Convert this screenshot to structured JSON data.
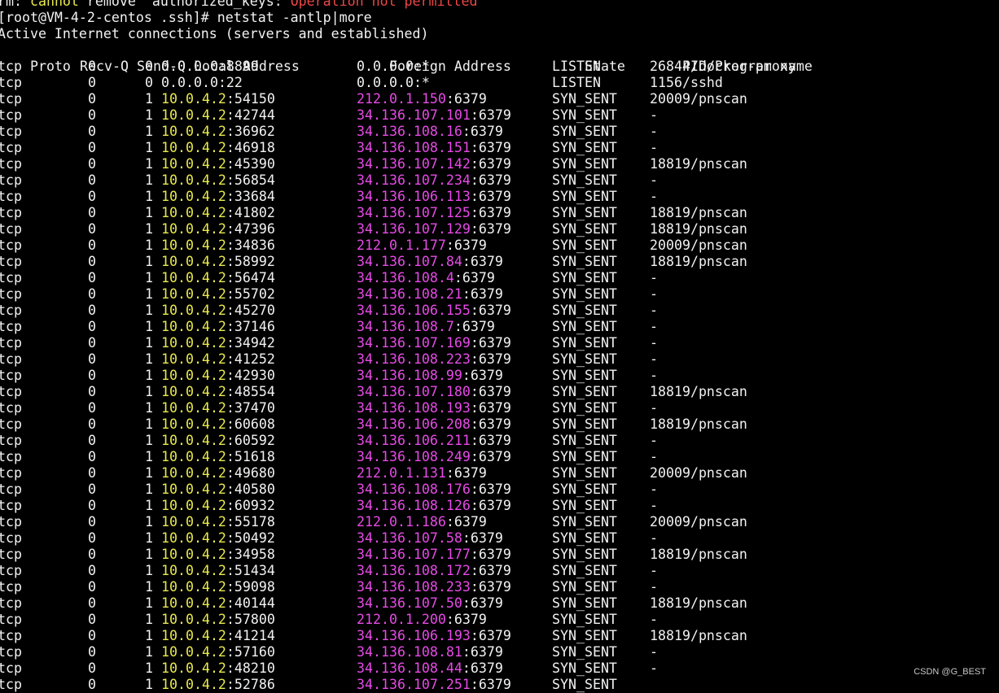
{
  "colors": {
    "background": "#000000",
    "text": "#f2f2f2",
    "local_ip": "#e9e94e",
    "foreign_ip": "#e84ae8",
    "error": "#f04646"
  },
  "terminal": {
    "rm_line": {
      "prefix": "rm: ",
      "cannot": "cannot",
      "remove": " remove  ",
      "file": "authorized_keys",
      "sep": ": ",
      "error": "Operation not permitted"
    },
    "prompt": "[root@VM-4-2-centos .ssh]# netstat -antlp|more",
    "banner": "Active Internet connections (servers and established)",
    "headers": {
      "proto": "Proto",
      "recvq": "Recv-Q",
      "sendq": "Send-Q",
      "local": "Local Address",
      "foreign": "Foreign Address",
      "state": "State",
      "prog": "PID/Program name"
    },
    "rows": [
      {
        "proto": "tcp",
        "recvq": "0",
        "sendq": "0",
        "local_ip": "0.0.0.0",
        "local_port": ":8899",
        "foreign_ip": "0.0.0.0",
        "foreign_port": ":*",
        "state": "LISTEN",
        "prog": "26844/docker-proxy",
        "colored": false
      },
      {
        "proto": "tcp",
        "recvq": "0",
        "sendq": "0",
        "local_ip": "0.0.0.0",
        "local_port": ":22",
        "foreign_ip": "0.0.0.0",
        "foreign_port": ":*",
        "state": "LISTEN",
        "prog": "1156/sshd",
        "colored": false
      },
      {
        "proto": "tcp",
        "recvq": "0",
        "sendq": "1",
        "local_ip": "10.0.4.2",
        "local_port": ":54150",
        "foreign_ip": "212.0.1.150",
        "foreign_port": ":6379",
        "state": "SYN_SENT",
        "prog": "20009/pnscan",
        "colored": true
      },
      {
        "proto": "tcp",
        "recvq": "0",
        "sendq": "1",
        "local_ip": "10.0.4.2",
        "local_port": ":42744",
        "foreign_ip": "34.136.107.101",
        "foreign_port": ":6379",
        "state": "SYN_SENT",
        "prog": "-",
        "colored": true
      },
      {
        "proto": "tcp",
        "recvq": "0",
        "sendq": "1",
        "local_ip": "10.0.4.2",
        "local_port": ":36962",
        "foreign_ip": "34.136.108.16",
        "foreign_port": ":6379",
        "state": "SYN_SENT",
        "prog": "-",
        "colored": true
      },
      {
        "proto": "tcp",
        "recvq": "0",
        "sendq": "1",
        "local_ip": "10.0.4.2",
        "local_port": ":46918",
        "foreign_ip": "34.136.108.151",
        "foreign_port": ":6379",
        "state": "SYN_SENT",
        "prog": "-",
        "colored": true
      },
      {
        "proto": "tcp",
        "recvq": "0",
        "sendq": "1",
        "local_ip": "10.0.4.2",
        "local_port": ":45390",
        "foreign_ip": "34.136.107.142",
        "foreign_port": ":6379",
        "state": "SYN_SENT",
        "prog": "18819/pnscan",
        "colored": true
      },
      {
        "proto": "tcp",
        "recvq": "0",
        "sendq": "1",
        "local_ip": "10.0.4.2",
        "local_port": ":56854",
        "foreign_ip": "34.136.107.234",
        "foreign_port": ":6379",
        "state": "SYN_SENT",
        "prog": "-",
        "colored": true
      },
      {
        "proto": "tcp",
        "recvq": "0",
        "sendq": "1",
        "local_ip": "10.0.4.2",
        "local_port": ":33684",
        "foreign_ip": "34.136.106.113",
        "foreign_port": ":6379",
        "state": "SYN_SENT",
        "prog": "-",
        "colored": true
      },
      {
        "proto": "tcp",
        "recvq": "0",
        "sendq": "1",
        "local_ip": "10.0.4.2",
        "local_port": ":41802",
        "foreign_ip": "34.136.107.125",
        "foreign_port": ":6379",
        "state": "SYN_SENT",
        "prog": "18819/pnscan",
        "colored": true
      },
      {
        "proto": "tcp",
        "recvq": "0",
        "sendq": "1",
        "local_ip": "10.0.4.2",
        "local_port": ":47396",
        "foreign_ip": "34.136.107.129",
        "foreign_port": ":6379",
        "state": "SYN_SENT",
        "prog": "18819/pnscan",
        "colored": true
      },
      {
        "proto": "tcp",
        "recvq": "0",
        "sendq": "1",
        "local_ip": "10.0.4.2",
        "local_port": ":34836",
        "foreign_ip": "212.0.1.177",
        "foreign_port": ":6379",
        "state": "SYN_SENT",
        "prog": "20009/pnscan",
        "colored": true
      },
      {
        "proto": "tcp",
        "recvq": "0",
        "sendq": "1",
        "local_ip": "10.0.4.2",
        "local_port": ":58992",
        "foreign_ip": "34.136.107.84",
        "foreign_port": ":6379",
        "state": "SYN_SENT",
        "prog": "18819/pnscan",
        "colored": true
      },
      {
        "proto": "tcp",
        "recvq": "0",
        "sendq": "1",
        "local_ip": "10.0.4.2",
        "local_port": ":56474",
        "foreign_ip": "34.136.108.4",
        "foreign_port": ":6379",
        "state": "SYN_SENT",
        "prog": "-",
        "colored": true
      },
      {
        "proto": "tcp",
        "recvq": "0",
        "sendq": "1",
        "local_ip": "10.0.4.2",
        "local_port": ":55702",
        "foreign_ip": "34.136.108.21",
        "foreign_port": ":6379",
        "state": "SYN_SENT",
        "prog": "-",
        "colored": true
      },
      {
        "proto": "tcp",
        "recvq": "0",
        "sendq": "1",
        "local_ip": "10.0.4.2",
        "local_port": ":45270",
        "foreign_ip": "34.136.106.155",
        "foreign_port": ":6379",
        "state": "SYN_SENT",
        "prog": "-",
        "colored": true
      },
      {
        "proto": "tcp",
        "recvq": "0",
        "sendq": "1",
        "local_ip": "10.0.4.2",
        "local_port": ":37146",
        "foreign_ip": "34.136.108.7",
        "foreign_port": ":6379",
        "state": "SYN_SENT",
        "prog": "-",
        "colored": true
      },
      {
        "proto": "tcp",
        "recvq": "0",
        "sendq": "1",
        "local_ip": "10.0.4.2",
        "local_port": ":34942",
        "foreign_ip": "34.136.107.169",
        "foreign_port": ":6379",
        "state": "SYN_SENT",
        "prog": "-",
        "colored": true
      },
      {
        "proto": "tcp",
        "recvq": "0",
        "sendq": "1",
        "local_ip": "10.0.4.2",
        "local_port": ":41252",
        "foreign_ip": "34.136.108.223",
        "foreign_port": ":6379",
        "state": "SYN_SENT",
        "prog": "-",
        "colored": true
      },
      {
        "proto": "tcp",
        "recvq": "0",
        "sendq": "1",
        "local_ip": "10.0.4.2",
        "local_port": ":42930",
        "foreign_ip": "34.136.108.99",
        "foreign_port": ":6379",
        "state": "SYN_SENT",
        "prog": "-",
        "colored": true
      },
      {
        "proto": "tcp",
        "recvq": "0",
        "sendq": "1",
        "local_ip": "10.0.4.2",
        "local_port": ":48554",
        "foreign_ip": "34.136.107.180",
        "foreign_port": ":6379",
        "state": "SYN_SENT",
        "prog": "18819/pnscan",
        "colored": true
      },
      {
        "proto": "tcp",
        "recvq": "0",
        "sendq": "1",
        "local_ip": "10.0.4.2",
        "local_port": ":37470",
        "foreign_ip": "34.136.108.193",
        "foreign_port": ":6379",
        "state": "SYN_SENT",
        "prog": "-",
        "colored": true
      },
      {
        "proto": "tcp",
        "recvq": "0",
        "sendq": "1",
        "local_ip": "10.0.4.2",
        "local_port": ":60608",
        "foreign_ip": "34.136.106.208",
        "foreign_port": ":6379",
        "state": "SYN_SENT",
        "prog": "18819/pnscan",
        "colored": true
      },
      {
        "proto": "tcp",
        "recvq": "0",
        "sendq": "1",
        "local_ip": "10.0.4.2",
        "local_port": ":60592",
        "foreign_ip": "34.136.106.211",
        "foreign_port": ":6379",
        "state": "SYN_SENT",
        "prog": "-",
        "colored": true
      },
      {
        "proto": "tcp",
        "recvq": "0",
        "sendq": "1",
        "local_ip": "10.0.4.2",
        "local_port": ":51618",
        "foreign_ip": "34.136.108.249",
        "foreign_port": ":6379",
        "state": "SYN_SENT",
        "prog": "-",
        "colored": true
      },
      {
        "proto": "tcp",
        "recvq": "0",
        "sendq": "1",
        "local_ip": "10.0.4.2",
        "local_port": ":49680",
        "foreign_ip": "212.0.1.131",
        "foreign_port": ":6379",
        "state": "SYN_SENT",
        "prog": "20009/pnscan",
        "colored": true
      },
      {
        "proto": "tcp",
        "recvq": "0",
        "sendq": "1",
        "local_ip": "10.0.4.2",
        "local_port": ":40580",
        "foreign_ip": "34.136.108.176",
        "foreign_port": ":6379",
        "state": "SYN_SENT",
        "prog": "-",
        "colored": true
      },
      {
        "proto": "tcp",
        "recvq": "0",
        "sendq": "1",
        "local_ip": "10.0.4.2",
        "local_port": ":60932",
        "foreign_ip": "34.136.108.126",
        "foreign_port": ":6379",
        "state": "SYN_SENT",
        "prog": "-",
        "colored": true
      },
      {
        "proto": "tcp",
        "recvq": "0",
        "sendq": "1",
        "local_ip": "10.0.4.2",
        "local_port": ":55178",
        "foreign_ip": "212.0.1.186",
        "foreign_port": ":6379",
        "state": "SYN_SENT",
        "prog": "20009/pnscan",
        "colored": true
      },
      {
        "proto": "tcp",
        "recvq": "0",
        "sendq": "1",
        "local_ip": "10.0.4.2",
        "local_port": ":50492",
        "foreign_ip": "34.136.107.58",
        "foreign_port": ":6379",
        "state": "SYN_SENT",
        "prog": "-",
        "colored": true
      },
      {
        "proto": "tcp",
        "recvq": "0",
        "sendq": "1",
        "local_ip": "10.0.4.2",
        "local_port": ":34958",
        "foreign_ip": "34.136.107.177",
        "foreign_port": ":6379",
        "state": "SYN_SENT",
        "prog": "18819/pnscan",
        "colored": true
      },
      {
        "proto": "tcp",
        "recvq": "0",
        "sendq": "1",
        "local_ip": "10.0.4.2",
        "local_port": ":51434",
        "foreign_ip": "34.136.108.172",
        "foreign_port": ":6379",
        "state": "SYN_SENT",
        "prog": "-",
        "colored": true
      },
      {
        "proto": "tcp",
        "recvq": "0",
        "sendq": "1",
        "local_ip": "10.0.4.2",
        "local_port": ":59098",
        "foreign_ip": "34.136.108.233",
        "foreign_port": ":6379",
        "state": "SYN_SENT",
        "prog": "-",
        "colored": true
      },
      {
        "proto": "tcp",
        "recvq": "0",
        "sendq": "1",
        "local_ip": "10.0.4.2",
        "local_port": ":40144",
        "foreign_ip": "34.136.107.50",
        "foreign_port": ":6379",
        "state": "SYN_SENT",
        "prog": "18819/pnscan",
        "colored": true
      },
      {
        "proto": "tcp",
        "recvq": "0",
        "sendq": "1",
        "local_ip": "10.0.4.2",
        "local_port": ":57800",
        "foreign_ip": "212.0.1.200",
        "foreign_port": ":6379",
        "state": "SYN_SENT",
        "prog": "-",
        "colored": true
      },
      {
        "proto": "tcp",
        "recvq": "0",
        "sendq": "1",
        "local_ip": "10.0.4.2",
        "local_port": ":41214",
        "foreign_ip": "34.136.106.193",
        "foreign_port": ":6379",
        "state": "SYN_SENT",
        "prog": "18819/pnscan",
        "colored": true
      },
      {
        "proto": "tcp",
        "recvq": "0",
        "sendq": "1",
        "local_ip": "10.0.4.2",
        "local_port": ":57160",
        "foreign_ip": "34.136.108.81",
        "foreign_port": ":6379",
        "state": "SYN_SENT",
        "prog": "-",
        "colored": true
      },
      {
        "proto": "tcp",
        "recvq": "0",
        "sendq": "1",
        "local_ip": "10.0.4.2",
        "local_port": ":48210",
        "foreign_ip": "34.136.108.44",
        "foreign_port": ":6379",
        "state": "SYN_SENT",
        "prog": "-",
        "colored": true
      },
      {
        "proto": "tcp",
        "recvq": "0",
        "sendq": "1",
        "local_ip": "10.0.4.2",
        "local_port": ":52786",
        "foreign_ip": "34.136.107.251",
        "foreign_port": ":6379",
        "state": "SYN_SENT",
        "prog": "",
        "colored": true
      }
    ]
  },
  "watermark": "CSDN @G_BEST"
}
